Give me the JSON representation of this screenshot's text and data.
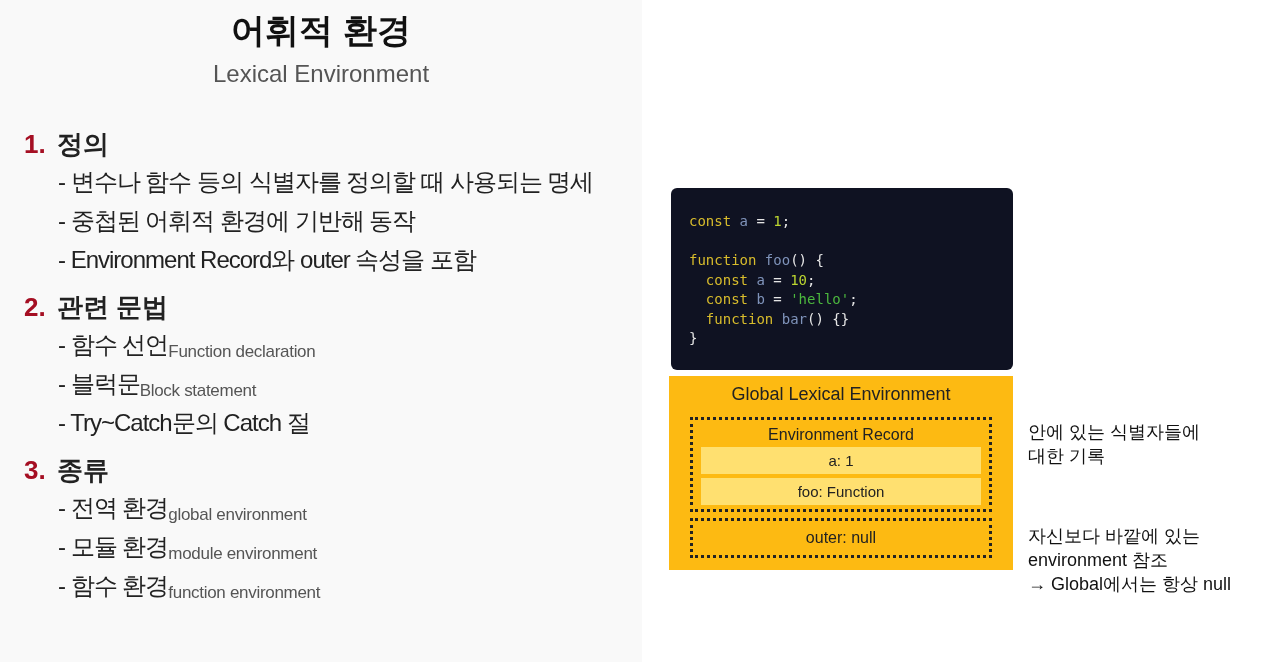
{
  "title": "어휘적 환경",
  "subtitle": "Lexical Environment",
  "sections": [
    {
      "number": "1.",
      "heading": "정의",
      "items": [
        {
          "text": "- 변수나 함수 등의 식별자를 정의할 때 사용되는 명세"
        },
        {
          "text": "- 중첩된 어휘적 환경에 기반해 동작"
        },
        {
          "text": "- Environment Record와 outer 속성을 포함"
        }
      ]
    },
    {
      "number": "2.",
      "heading": "관련 문법",
      "items": [
        {
          "text": "- 함수 선언",
          "note": "Function declaration"
        },
        {
          "text": "- 블럭문",
          "note": "Block statement"
        },
        {
          "text": "- Try~Catch문의 Catch 절"
        }
      ]
    },
    {
      "number": "3.",
      "heading": "종류",
      "items": [
        {
          "text": "- 전역 환경",
          "note": "global environment"
        },
        {
          "text": "- 모듈 환경",
          "note": "module environment"
        },
        {
          "text": "- 함수 환경",
          "note": "function environment"
        }
      ]
    }
  ],
  "code": [
    {
      "tokens": [
        {
          "kind": "keyword",
          "t": "const "
        },
        {
          "kind": "name",
          "t": "a"
        },
        {
          "kind": "punct",
          "t": " = "
        },
        {
          "kind": "number",
          "t": "1"
        },
        {
          "kind": "punct",
          "t": ";"
        }
      ]
    },
    {
      "space_before": true,
      "tokens": [
        {
          "kind": "keyword",
          "t": "function "
        },
        {
          "kind": "name",
          "t": "foo"
        },
        {
          "kind": "punct",
          "t": "() {"
        }
      ]
    },
    {
      "tokens": [
        {
          "kind": "keyword",
          "t": "  const "
        },
        {
          "kind": "name",
          "t": "a"
        },
        {
          "kind": "punct",
          "t": " = "
        },
        {
          "kind": "number",
          "t": "10"
        },
        {
          "kind": "punct",
          "t": ";"
        }
      ]
    },
    {
      "tokens": [
        {
          "kind": "keyword",
          "t": "  const "
        },
        {
          "kind": "name",
          "t": "b"
        },
        {
          "kind": "punct",
          "t": " = "
        },
        {
          "kind": "string",
          "t": "'hello'"
        },
        {
          "kind": "punct",
          "t": ";"
        }
      ]
    },
    {
      "tokens": [
        {
          "kind": "keyword",
          "t": "  function "
        },
        {
          "kind": "name",
          "t": "bar"
        },
        {
          "kind": "punct",
          "t": "() {}"
        }
      ]
    },
    {
      "tokens": [
        {
          "kind": "punct",
          "t": "}"
        }
      ]
    }
  ],
  "diagram": {
    "title": "Global Lexical Environment",
    "record": {
      "title": "Environment Record",
      "entries": [
        "a: 1",
        "foo: Function"
      ]
    },
    "outer": "outer: null"
  },
  "notes": [
    {
      "lines": [
        "안에 있는 식별자들에",
        "대한 기록"
      ]
    },
    {
      "lines": [
        "자신보다 바깥에 있는",
        "environment 참조",
        "→ Global에서는 항상 null"
      ]
    }
  ]
}
